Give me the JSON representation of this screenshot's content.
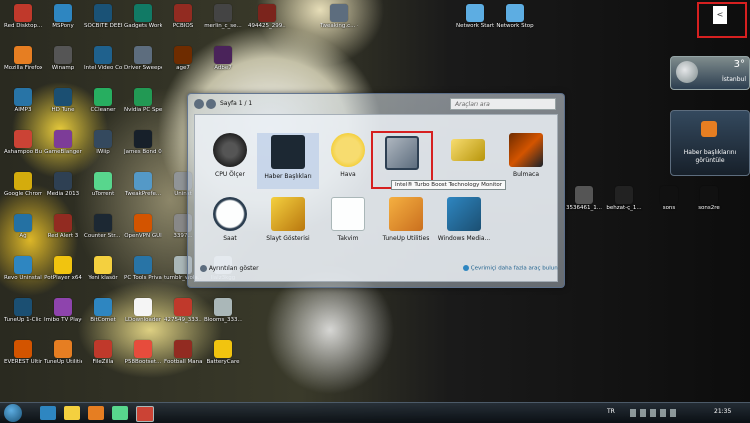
{
  "desktop_icons": [
    {
      "label": "Red Disktop...",
      "color": "#c0392b"
    },
    {
      "label": "MSPony",
      "color": "#2e86c1"
    },
    {
      "label": "SOCBITE DEEBLR",
      "color": "#1a5276"
    },
    {
      "label": "Gadgets Workshop",
      "color": "#117a65"
    },
    {
      "label": "PCBIOS",
      "color": "#922b21"
    },
    {
      "label": "merlin_c_se...",
      "color": "#444"
    },
    {
      "label": "494425_299...",
      "color": "#7b241c"
    },
    {
      "label": "Mozilla Firefox",
      "color": "#e67e22"
    },
    {
      "label": "Winamp",
      "color": "#555"
    },
    {
      "label": "Intel Video Converter",
      "color": "#1f618d"
    },
    {
      "label": "Driver Sweeper",
      "color": "#5d6d7e"
    },
    {
      "label": "age7",
      "color": "#6e2c00"
    },
    {
      "label": "Adbe7",
      "color": "#4a235a"
    },
    {
      "label": "AIMP3",
      "color": "#2874a6"
    },
    {
      "label": "HD Tune",
      "color": "#1b4f72"
    },
    {
      "label": "CCleaner",
      "color": "#27ae60"
    },
    {
      "label": "Nvidia PC Speed Tune",
      "color": "#229954"
    },
    {
      "label": "Ashampoo Burning...",
      "color": "#cb4335"
    },
    {
      "label": "GameBlanger",
      "color": "#7d3c98"
    },
    {
      "label": "IWiip",
      "color": "#34495e"
    },
    {
      "label": "James Bond 007 (MM)",
      "color": "#17202a"
    },
    {
      "label": "Google Chrome",
      "color": "#d4ac0d"
    },
    {
      "label": "Media 2013",
      "color": "#2e4053"
    },
    {
      "label": "uTorrent",
      "color": "#58d68d"
    },
    {
      "label": "TweakPrefe...",
      "color": "#5499c7"
    },
    {
      "label": "Uninst",
      "color": "#909497"
    },
    {
      "label": "Ağ",
      "color": "#2471a3"
    },
    {
      "label": "Red Alert 3",
      "color": "#922b21"
    },
    {
      "label": "Counter Str... 1.6",
      "color": "#1c2833"
    },
    {
      "label": "OpenVPN GUI",
      "color": "#d35400"
    },
    {
      "label": "Revo Uninstaller",
      "color": "#2e86c1"
    },
    {
      "label": "PotPlayer x64",
      "color": "#f1c40f"
    },
    {
      "label": "Yeni klasör",
      "color": "#f4d03f"
    },
    {
      "label": "PC Tools Privacy...",
      "color": "#2874a6"
    },
    {
      "label": "tumblr_wola...",
      "color": "#aab7b8"
    },
    {
      "label": "llalz3kgg",
      "color": "#d5d8dc"
    },
    {
      "label": "TuneUp 1-Click Main...",
      "color": "#1b4f72"
    },
    {
      "label": "Imibo TV Player",
      "color": "#8e44ad"
    },
    {
      "label": "BitComet",
      "color": "#2e86c1"
    },
    {
      "label": "LDownloader",
      "color": "#f5f5f5"
    },
    {
      "label": "427549_333...",
      "color": "#c0392b"
    },
    {
      "label": "Blooms_333...",
      "color": "#aab7b8"
    },
    {
      "label": "EVEREST Ultima...",
      "color": "#d35400"
    },
    {
      "label": "TuneUp Utilities 2012",
      "color": "#e67e22"
    },
    {
      "label": "FileZilla",
      "color": "#c0392b"
    },
    {
      "label": "P58Bootset...",
      "color": "#e74c3c"
    },
    {
      "label": "Football Manage...",
      "color": "#922b21"
    },
    {
      "label": "BatteryCare",
      "color": "#f1c40f"
    },
    {
      "label": "Network Start",
      "color": "#5dade2"
    },
    {
      "label": "Network Stop",
      "color": "#5dade2"
    },
    {
      "label": "Tweaking.c... - Windows ...",
      "color": "#5d6d7e"
    },
    {
      "label": "3397...",
      "color": "#888"
    },
    {
      "label": "3536461_1...",
      "color": "#555"
    },
    {
      "label": "behzat-ç_1...",
      "color": "#222"
    },
    {
      "label": "sons",
      "color": "#111"
    },
    {
      "label": "sons2re",
      "color": "#111"
    }
  ],
  "gadget_window": {
    "page_label": "Sayfa 1 / 1",
    "search_placeholder": "Araçları ara",
    "items": [
      {
        "label": "CPU Ölçer"
      },
      {
        "label": "Haber Başlıkları"
      },
      {
        "label": "Hava"
      },
      {
        "label": "Intel® Turbo Boost Technology Monitor"
      },
      {
        "label": ""
      },
      {
        "label": "Bulmaca"
      },
      {
        "label": "Saat"
      },
      {
        "label": "Slayt Gösterisi"
      },
      {
        "label": "Takvim"
      },
      {
        "label": "TuneUp Utilities"
      },
      {
        "label": "Windows Media..."
      }
    ],
    "tooltip": "Intel® Turbo Boost Technology Monitor",
    "details_label": "Ayrıntıları göster",
    "online_link": "Çevrimiçi daha fazla araç bulun"
  },
  "sidebar": {
    "weather_temp": "3°",
    "weather_city": "İstanbul",
    "news_text": "Haber başlıklarını görüntüle",
    "collapse_glyph": "<"
  },
  "taskbar": {
    "language": "TR",
    "clock": "21:35"
  }
}
